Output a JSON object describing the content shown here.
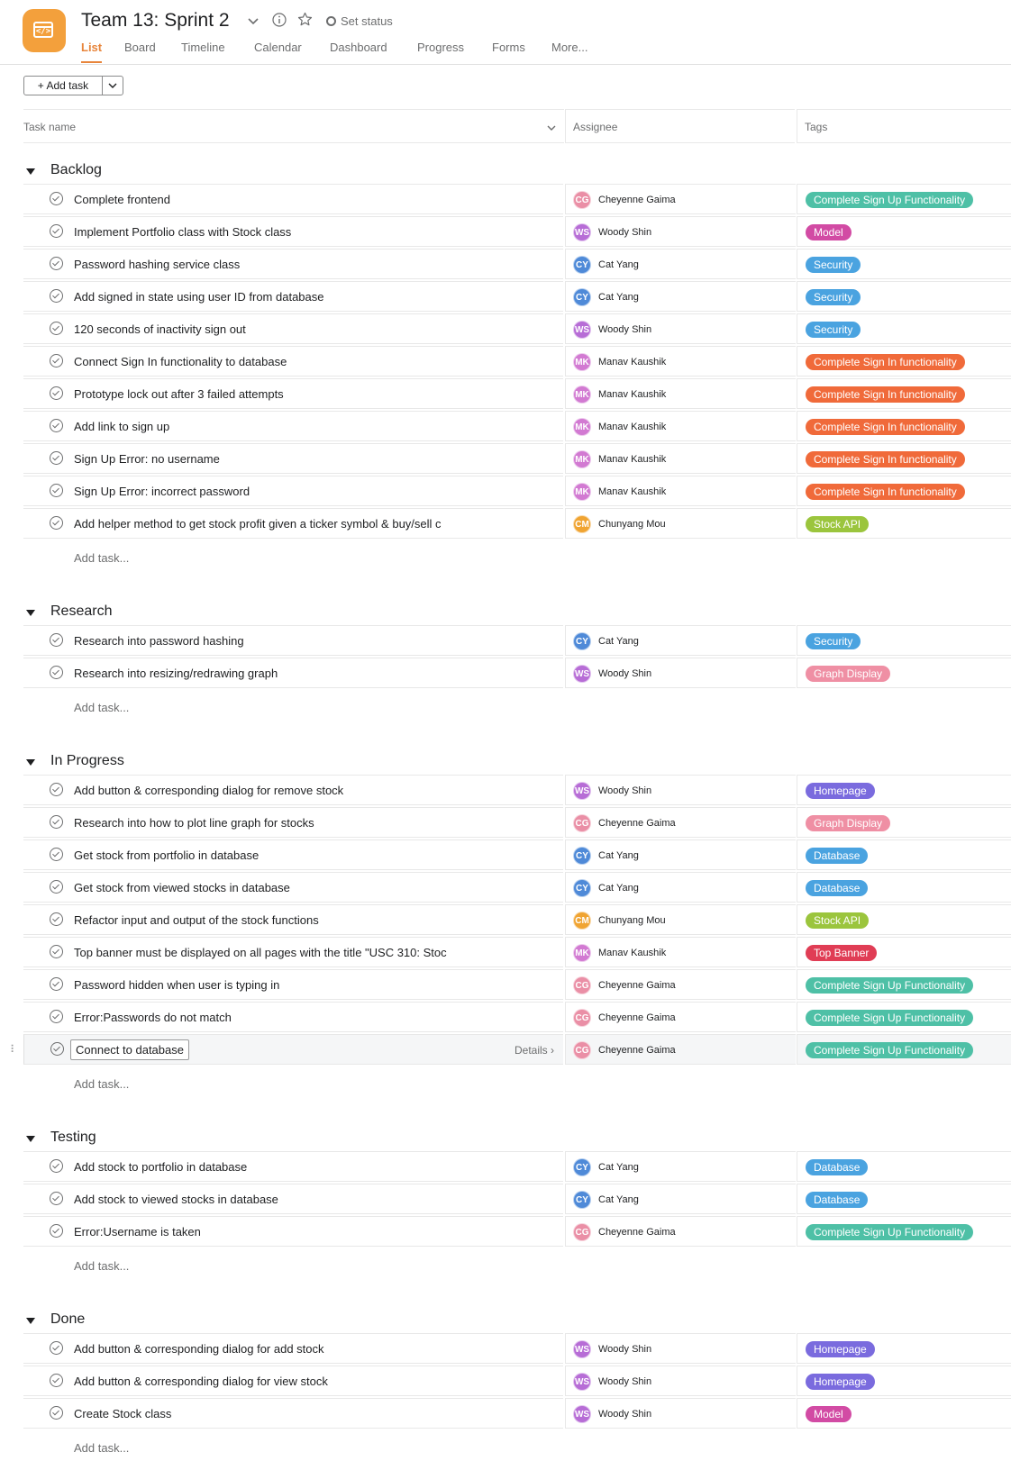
{
  "project": {
    "title": "Team 13: Sprint 2",
    "icon": "code-window-icon",
    "accent": "#f3a03c",
    "set_status": "Set status"
  },
  "tabs": [
    {
      "label": "List",
      "active": true
    },
    {
      "label": "Board"
    },
    {
      "label": "Timeline"
    },
    {
      "label": "Calendar"
    },
    {
      "label": "Dashboard"
    },
    {
      "label": "Progress"
    },
    {
      "label": "Forms"
    },
    {
      "label": "More..."
    }
  ],
  "toolbar": {
    "add_task_label": "Add task"
  },
  "columns": {
    "task": "Task name",
    "assignee": "Assignee",
    "tags": "Tags"
  },
  "add_task_placeholder": "Add task...",
  "details_label": "Details",
  "people": {
    "CG": {
      "name": "Cheyenne Gaima",
      "color": "#ea8fa6"
    },
    "WS": {
      "name": "Woody Shin",
      "color": "#b76dd6"
    },
    "CY": {
      "name": "Cat Yang",
      "color": "#4f8ad8"
    },
    "MK": {
      "name": "Manav Kaushik",
      "color": "#d27ad2"
    },
    "CM": {
      "name": "Chunyang Mou",
      "color": "#f0a432"
    }
  },
  "tag_colors": {
    "Complete Sign Up Functionality": "#4ec0a6",
    "Model": "#d24ba4",
    "Security": "#4aa3e0",
    "Complete Sign In functionality": "#f06a3a",
    "Stock API": "#9bc53d",
    "Graph Display": "#ef8fa4",
    "Homepage": "#7a6bde",
    "Database": "#4aa3e0",
    "Top Banner": "#e03d55"
  },
  "sections": [
    {
      "title": "Backlog",
      "tasks": [
        {
          "name": "Complete frontend",
          "assignee": "CG",
          "tag": "Complete Sign Up Functionality"
        },
        {
          "name": "Implement Portfolio class with Stock class",
          "assignee": "WS",
          "tag": "Model"
        },
        {
          "name": "Password hashing service class",
          "assignee": "CY",
          "tag": "Security"
        },
        {
          "name": "Add signed in state using user ID from database",
          "assignee": "CY",
          "tag": "Security"
        },
        {
          "name": "120 seconds of inactivity sign out",
          "assignee": "WS",
          "tag": "Security"
        },
        {
          "name": "Connect Sign In functionality to database",
          "assignee": "MK",
          "tag": "Complete Sign In functionality"
        },
        {
          "name": "Prototype lock out after 3 failed attempts",
          "assignee": "MK",
          "tag": "Complete Sign In functionality"
        },
        {
          "name": "Add link to sign up",
          "assignee": "MK",
          "tag": "Complete Sign In functionality"
        },
        {
          "name": "Sign Up Error: no username",
          "assignee": "MK",
          "tag": "Complete Sign In functionality"
        },
        {
          "name": "Sign Up Error: incorrect password",
          "assignee": "MK",
          "tag": "Complete Sign In functionality"
        },
        {
          "name": "Add helper method to get stock profit given a ticker symbol & buy/sell c",
          "assignee": "CM",
          "tag": "Stock API"
        }
      ]
    },
    {
      "title": "Research",
      "tasks": [
        {
          "name": "Research into password hashing",
          "assignee": "CY",
          "tag": "Security"
        },
        {
          "name": "Research into resizing/redrawing graph",
          "assignee": "WS",
          "tag": "Graph Display"
        }
      ]
    },
    {
      "title": "In Progress",
      "tasks": [
        {
          "name": "Add button & corresponding dialog for remove stock",
          "assignee": "WS",
          "tag": "Homepage"
        },
        {
          "name": "Research into how to plot line graph for stocks",
          "assignee": "CG",
          "tag": "Graph Display"
        },
        {
          "name": "Get stock from portfolio in database",
          "assignee": "CY",
          "tag": "Database"
        },
        {
          "name": "Get stock from viewed stocks in database",
          "assignee": "CY",
          "tag": "Database"
        },
        {
          "name": "Refactor input and output of the stock functions",
          "assignee": "CM",
          "tag": "Stock API"
        },
        {
          "name": "Top banner must be displayed on all pages with the title \"USC 310: Stoc",
          "assignee": "MK",
          "tag": "Top Banner"
        },
        {
          "name": "Password hidden when user is typing in",
          "assignee": "CG",
          "tag": "Complete Sign Up Functionality"
        },
        {
          "name": "Error:Passwords do not match",
          "assignee": "CG",
          "tag": "Complete Sign Up Functionality"
        },
        {
          "name": "Connect to database",
          "assignee": "CG",
          "tag": "Complete Sign Up Functionality",
          "highlighted": true
        }
      ]
    },
    {
      "title": "Testing",
      "tasks": [
        {
          "name": "Add stock to portfolio in database",
          "assignee": "CY",
          "tag": "Database"
        },
        {
          "name": "Add stock to viewed stocks in database",
          "assignee": "CY",
          "tag": "Database"
        },
        {
          "name": "Error:Username is taken",
          "assignee": "CG",
          "tag": "Complete Sign Up Functionality"
        }
      ]
    },
    {
      "title": "Done",
      "tasks": [
        {
          "name": "Add button & corresponding dialog for add stock",
          "assignee": "WS",
          "tag": "Homepage"
        },
        {
          "name": "Add button & corresponding dialog for view stock",
          "assignee": "WS",
          "tag": "Homepage"
        },
        {
          "name": "Create Stock class",
          "assignee": "WS",
          "tag": "Model"
        }
      ]
    }
  ]
}
